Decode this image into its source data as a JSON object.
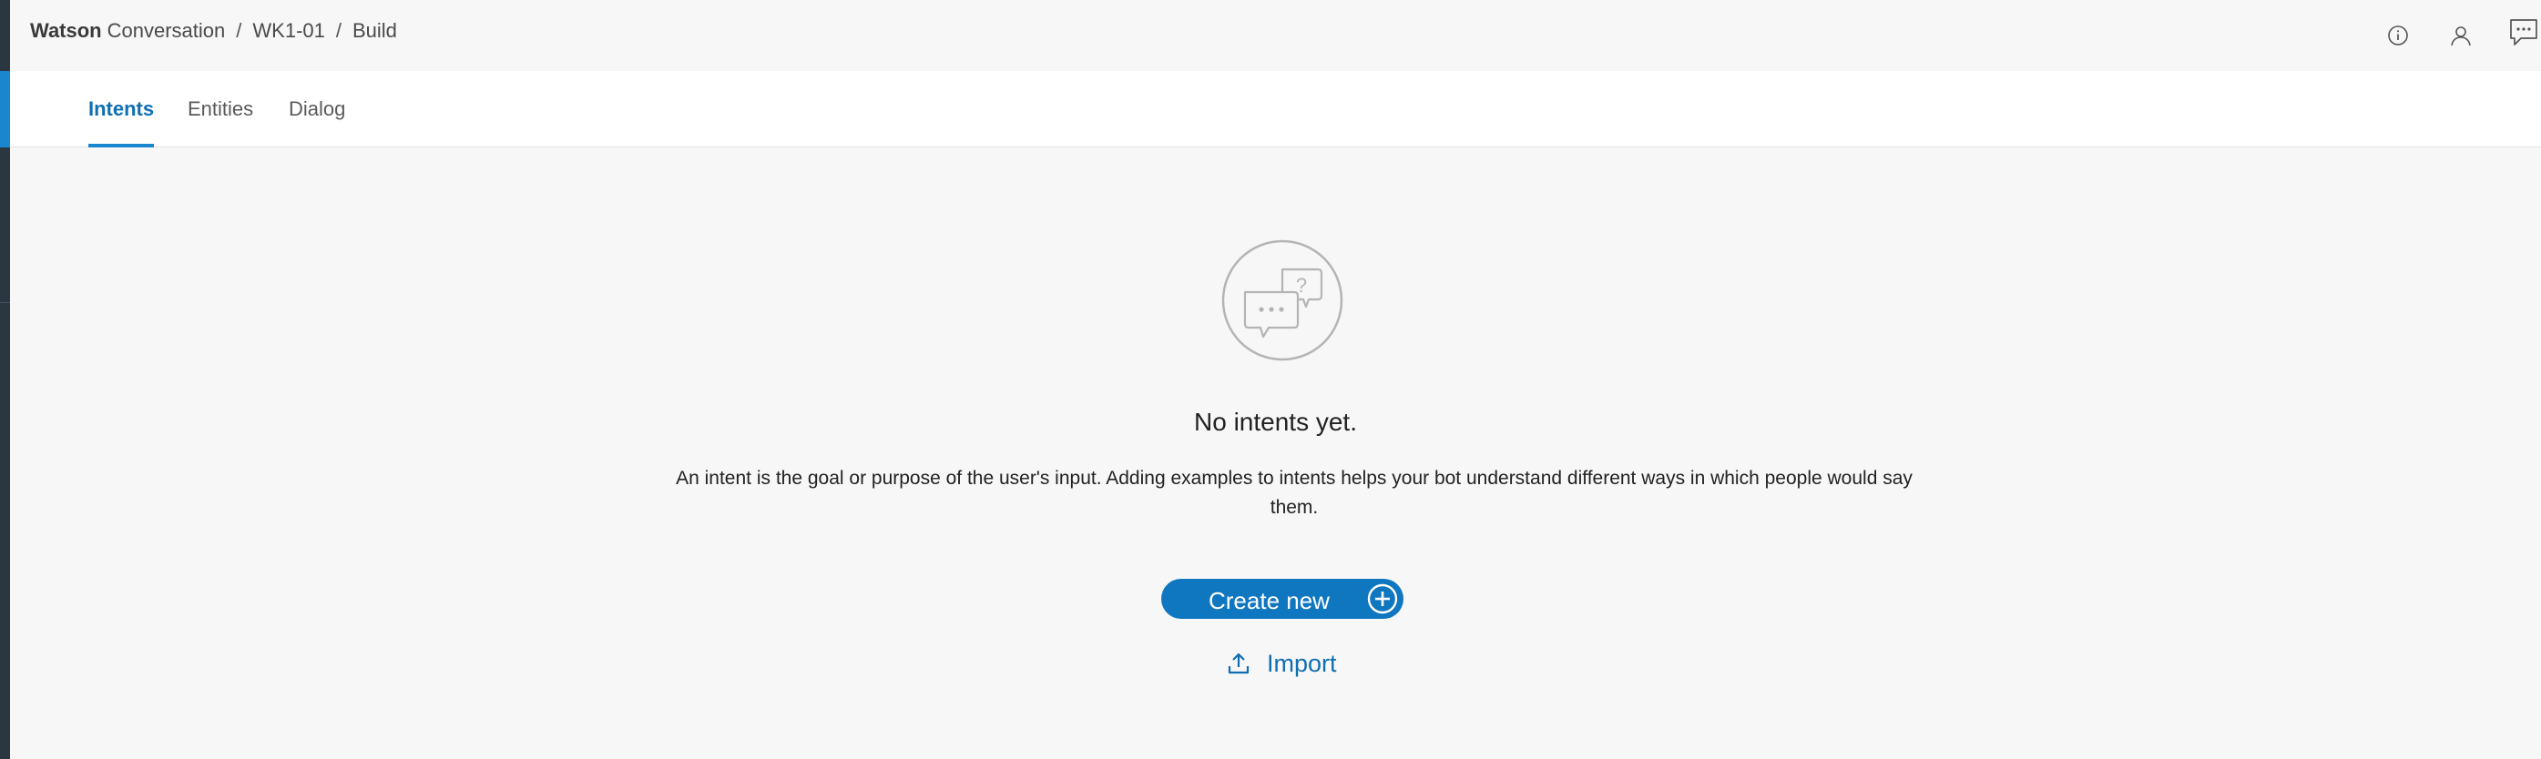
{
  "breadcrumb": {
    "brand": "Watson",
    "product": "Conversation",
    "separator": "/",
    "workspace": "WK1-01",
    "section": "Build"
  },
  "header_icons": [
    "info-icon",
    "user-icon",
    "chat-feedback-icon"
  ],
  "tabs": [
    {
      "label": "Intents",
      "active": true
    },
    {
      "label": "Entities",
      "active": false
    },
    {
      "label": "Dialog",
      "active": false
    }
  ],
  "empty_state": {
    "icon": "chat-question-icon",
    "title": "No intents yet.",
    "description": "An intent is the goal or purpose of the user's input. Adding examples to intents helps your bot understand different ways in which people would say them.",
    "create_label": "Create new",
    "import_label": "Import"
  },
  "colors": {
    "accent": "#0f76c0",
    "rail": "#2a3640",
    "rail_active": "#1a86d0",
    "background": "#f7f7f7"
  }
}
